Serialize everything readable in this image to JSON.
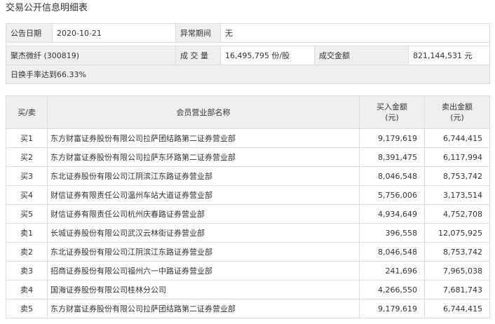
{
  "page_title": "交易公开信息明细表",
  "info": {
    "date_label": "公告日期",
    "date_value": "2020-10-21",
    "period_label": "异常期间",
    "period_value": "无",
    "stock_name": "聚杰微纤 (300819)",
    "volume_label": "成 交 量",
    "volume_value": "16,495,795 份/股",
    "amount_label": "成交金额",
    "amount_value": "821,144,531 元",
    "reason": "日换手率达到66.33%"
  },
  "detail": {
    "headers": {
      "side": "买/卖",
      "name": "会员营业部名称",
      "buy_line1": "买入金额",
      "buy_line2": "(元)",
      "sell_line1": "卖出金额",
      "sell_line2": "(元)"
    },
    "rows": [
      {
        "side": "买1",
        "name": "东方财富证券股份有限公司拉萨团结路第二证券营业部",
        "buy": "9,179,619",
        "sell": "6,744,415"
      },
      {
        "side": "买2",
        "name": "东方财富证券股份有限公司拉萨东环路第二证券营业部",
        "buy": "8,391,475",
        "sell": "6,117,994"
      },
      {
        "side": "买3",
        "name": "东北证券股份有限公司江阴滨江东路证券营业部",
        "buy": "8,046,548",
        "sell": "8,753,742"
      },
      {
        "side": "买4",
        "name": "财信证券有限责任公司温州车站大道证券营业部",
        "buy": "5,756,006",
        "sell": "3,173,514"
      },
      {
        "side": "买5",
        "name": "财信证券有限责任公司杭州庆春路证券营业部",
        "buy": "4,934,649",
        "sell": "4,752,708"
      },
      {
        "side": "卖1",
        "name": "长城证券股份有限公司武汉云林街证券营业部",
        "buy": "396,558",
        "sell": "12,075,925"
      },
      {
        "side": "卖2",
        "name": "东北证券股份有限公司江阴滨江东路证券营业部",
        "buy": "8,046,548",
        "sell": "8,753,742"
      },
      {
        "side": "卖3",
        "name": "招商证券股份有限公司福州六一中路证券营业部",
        "buy": "241,696",
        "sell": "7,965,038"
      },
      {
        "side": "卖4",
        "name": "国海证券股份有限公司桂林分公司",
        "buy": "4,266,550",
        "sell": "7,681,743"
      },
      {
        "side": "卖5",
        "name": "东方财富证券股份有限公司拉萨团结路第二证券营业部",
        "buy": "9,179,619",
        "sell": "6,744,415"
      }
    ]
  }
}
